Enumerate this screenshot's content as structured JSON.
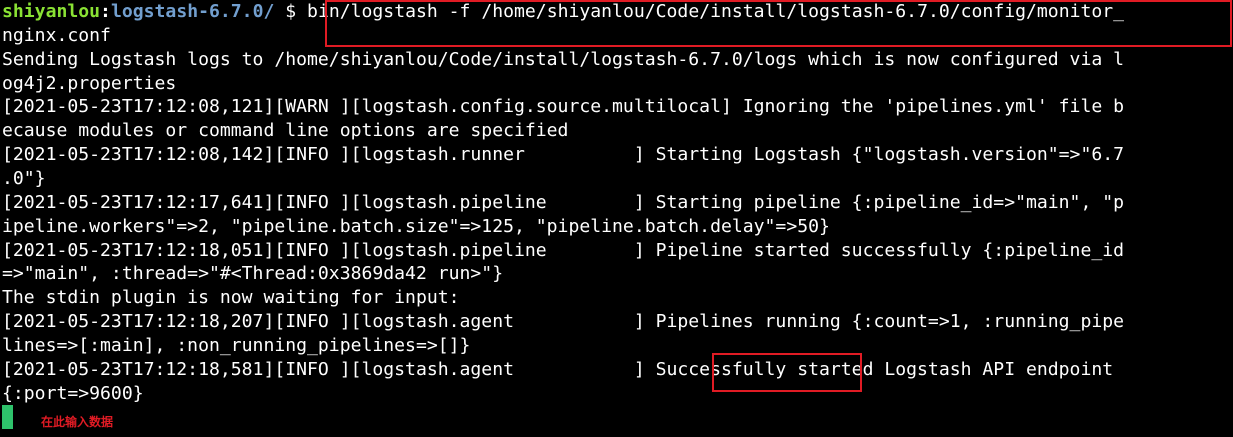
{
  "terminal": {
    "prompt": {
      "user": "shiyanlou",
      "sep": ":",
      "path": "logstash-6.7.0/",
      "dollar": " $ "
    },
    "command": "bin/logstash -f /home/shiyanlou/Code/install/logstash-6.7.0/config/monitor_",
    "lines": [
      "nginx.conf",
      "Sending Logstash logs to /home/shiyanlou/Code/install/logstash-6.7.0/logs which is now configured via l",
      "og4j2.properties",
      "[2021-05-23T17:12:08,121][WARN ][logstash.config.source.multilocal] Ignoring the 'pipelines.yml' file b",
      "ecause modules or command line options are specified",
      "[2021-05-23T17:12:08,142][INFO ][logstash.runner          ] Starting Logstash {\"logstash.version\"=>\"6.7",
      ".0\"}",
      "[2021-05-23T17:12:17,641][INFO ][logstash.pipeline        ] Starting pipeline {:pipeline_id=>\"main\", \"p",
      "ipeline.workers\"=>2, \"pipeline.batch.size\"=>125, \"pipeline.batch.delay\"=>50}",
      "[2021-05-23T17:12:18,051][INFO ][logstash.pipeline        ] Pipeline started successfully {:pipeline_id",
      "=>\"main\", :thread=>\"#<Thread:0x3869da42 run>\"}",
      "The stdin plugin is now waiting for input:",
      "[2021-05-23T17:12:18,207][INFO ][logstash.agent           ] Pipelines running {:count=>1, :running_pipe",
      "lines=>[:main], :non_running_pipelines=>[]}",
      "[2021-05-23T17:12:18,581][INFO ][logstash.agent           ] Successfully started Logstash API endpoint ",
      "{:port=>9600}"
    ],
    "annotation": "在此输入数据",
    "colors": {
      "background": "#000000",
      "text": "#ffffff",
      "prompt_user": "#8ae234",
      "prompt_path": "#729fcf",
      "cursor": "#2ec26b",
      "highlight": "#e01b24"
    }
  }
}
